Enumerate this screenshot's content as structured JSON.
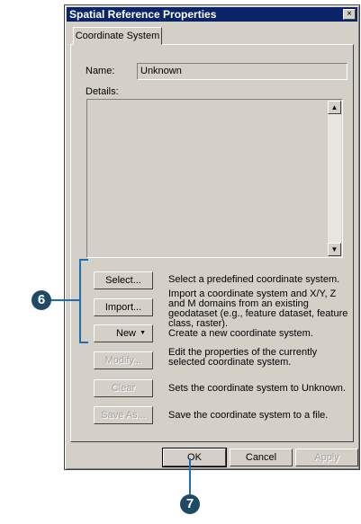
{
  "window": {
    "title": "Spatial Reference Properties",
    "close_glyph": "×"
  },
  "tab": {
    "label": "Coordinate System"
  },
  "name": {
    "label": "Name:",
    "value": "Unknown"
  },
  "details": {
    "label": "Details:"
  },
  "actions": [
    {
      "button": "Select...",
      "description": "Select a predefined coordinate system.",
      "enabled": true
    },
    {
      "button": "Import...",
      "description": "Import a coordinate system and X/Y, Z and M domains from an existing geodataset (e.g., feature dataset, feature class, raster).",
      "enabled": true
    },
    {
      "button": "New",
      "description": "Create a new coordinate system.",
      "enabled": true,
      "has_dropdown": true
    },
    {
      "button": "Modify...",
      "description": "Edit the properties of the currently selected coordinate system.",
      "enabled": false
    },
    {
      "button": "Clear",
      "description": "Sets the coordinate system to Unknown.",
      "enabled": false
    },
    {
      "button": "Save As...",
      "description": "Save the coordinate system to a file.",
      "enabled": false
    }
  ],
  "footer": {
    "ok": "OK",
    "cancel": "Cancel",
    "apply": "Apply"
  },
  "callouts": {
    "six": "6",
    "seven": "7"
  },
  "colors": {
    "callout": "#1e4a66",
    "bracket": "#1e6fb0",
    "titlebar": "#0a246a"
  }
}
